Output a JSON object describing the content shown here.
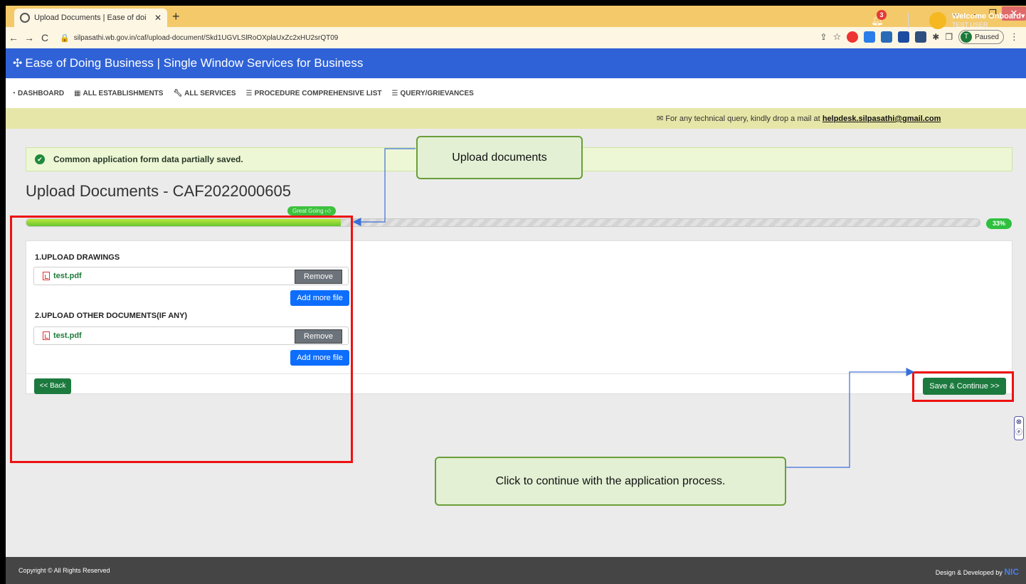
{
  "browser": {
    "tab_title": "Upload Documents | Ease of doi",
    "tab_close": "✕",
    "new_tab": "+",
    "url": "silpasathi.wb.gov.in/caf/upload-document/Skd1UGVLSlRoOXplaUxZc2xHU2srQT09",
    "profile_initial": "T",
    "profile_status": "Paused",
    "window_controls": [
      "⌄",
      "–",
      "❐",
      "✕"
    ]
  },
  "header": {
    "brand": "Ease of Doing Business | Single Window Services for Business",
    "notification_count": "3",
    "welcome": "Welcome Onboard",
    "username": "TEST USER"
  },
  "menu": {
    "items": [
      {
        "label": "DASHBOARD",
        "icon": "dashboard-icon"
      },
      {
        "label": "ALL ESTABLISHMENTS",
        "icon": "building-icon"
      },
      {
        "label": "ALL SERVICES",
        "icon": "wrench-icon"
      },
      {
        "label": "PROCEDURE COMPREHENSIVE LIST",
        "icon": "list-icon"
      },
      {
        "label": "QUERY/GRIEVANCES",
        "icon": "list-icon"
      }
    ]
  },
  "info": {
    "message": "For any technical query, kindly drop a mail at",
    "email": "helpdesk.silpasathi@gmail.com"
  },
  "alert": {
    "message": "Common application form data partially saved."
  },
  "page": {
    "title": "Upload Documents - CAF2022000605"
  },
  "progress": {
    "badge": "Great Going",
    "percent_label": "33%",
    "value": 0.33
  },
  "sections": [
    {
      "title": "1.UPLOAD DRAWINGS",
      "file": "test.pdf",
      "remove_label": "Remove",
      "add_label": "Add more file"
    },
    {
      "title": "2.UPLOAD OTHER DOCUMENTS(IF ANY)",
      "file": "test.pdf",
      "remove_label": "Remove",
      "add_label": "Add more file"
    }
  ],
  "actions": {
    "back": "<< Back",
    "save": "Save & Continue >>"
  },
  "callouts": {
    "upload": "Upload documents",
    "continue": "Click to continue with the application process."
  },
  "footer": {
    "copyright": "Copyright © All Rights Reserved",
    "design": "Design & Developed by",
    "nic": "NIC"
  },
  "colors": {
    "header_blue": "#2f62d6",
    "success_green": "#1c7a3e",
    "highlight_red": "#ee1111",
    "callout_fill": "#e3f0d4"
  }
}
